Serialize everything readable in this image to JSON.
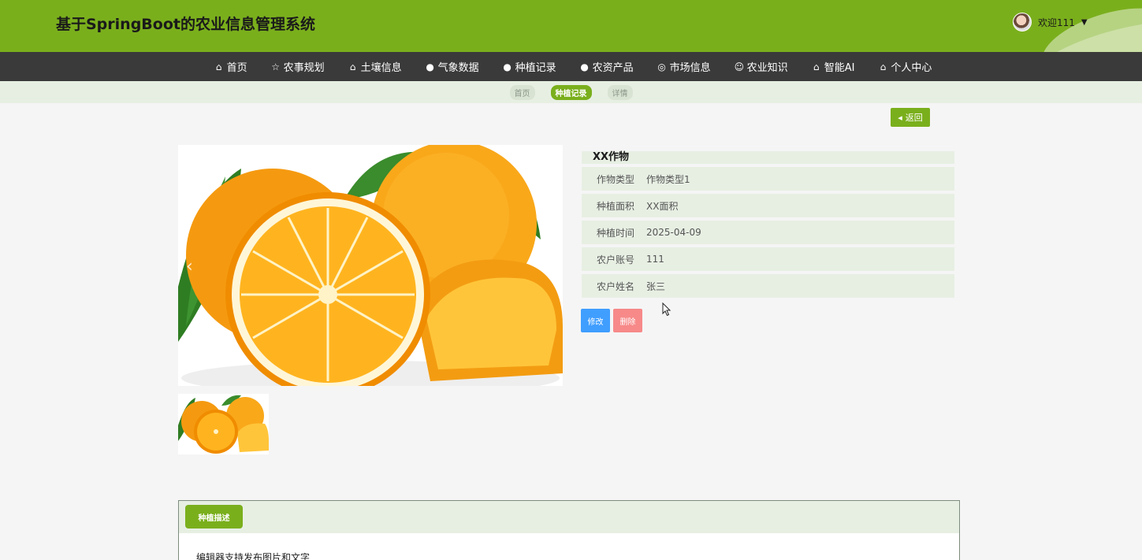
{
  "header": {
    "title": "基于SpringBoot的农业信息管理系统",
    "user_label": "欢迎111",
    "user_caret": "▼"
  },
  "nav": {
    "items": [
      {
        "label": "首页",
        "icon": "home-icon"
      },
      {
        "label": "农事规划",
        "icon": "star-icon"
      },
      {
        "label": "土壤信息",
        "icon": "bag-icon"
      },
      {
        "label": "气象数据",
        "icon": "info-icon"
      },
      {
        "label": "种植记录",
        "icon": "question-icon"
      },
      {
        "label": "农资产品",
        "icon": "info-icon"
      },
      {
        "label": "市场信息",
        "icon": "target-icon"
      },
      {
        "label": "农业知识",
        "icon": "smile-icon"
      },
      {
        "label": "智能AI",
        "icon": "home-icon"
      },
      {
        "label": "个人中心",
        "icon": "home-icon"
      }
    ]
  },
  "breadcrumb": {
    "items": [
      "首页",
      "种植记录",
      "详情"
    ]
  },
  "back_button": "返回",
  "detail": {
    "title": "XX作物",
    "rows": [
      {
        "label": "作物类型",
        "value": "作物类型1"
      },
      {
        "label": "种植面积",
        "value": "XX面积"
      },
      {
        "label": "种植时间",
        "value": "2025-04-09"
      },
      {
        "label": "农户账号",
        "value": "111"
      },
      {
        "label": "农户姓名",
        "value": "张三"
      }
    ]
  },
  "actions": {
    "edit": "修改",
    "delete": "删除"
  },
  "description": {
    "tab_label": "种植描述",
    "text": "编辑器支持发布图片和文字"
  },
  "colors": {
    "primary": "#7aaf1c",
    "nav_bg": "#3a3a3a",
    "edit": "#409eff",
    "delete": "#f78989"
  }
}
